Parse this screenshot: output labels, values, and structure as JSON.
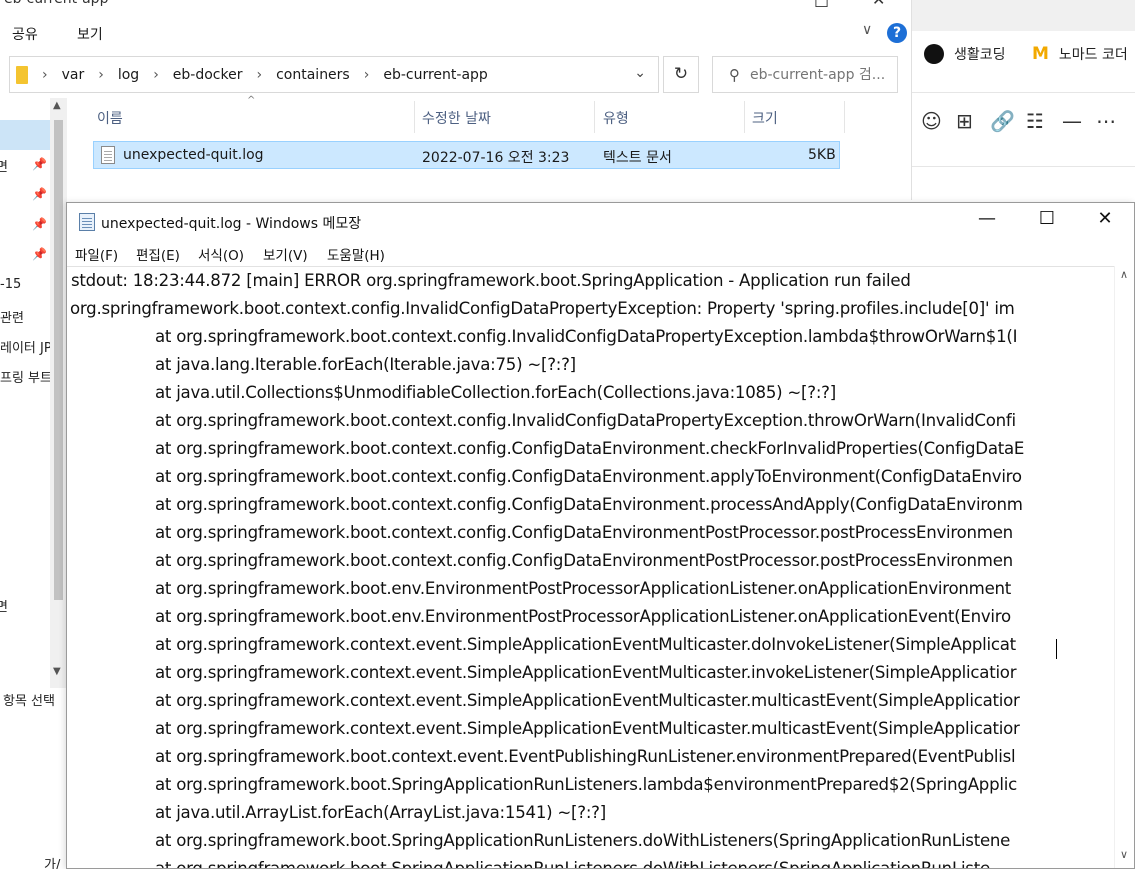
{
  "explorer": {
    "title_partial": "eb-current-app",
    "ribbon": {
      "share": "공유",
      "view": "보기"
    },
    "address": {
      "crumbs": [
        "var",
        "log",
        "eb-docker",
        "containers",
        "eb-current-app"
      ]
    },
    "search_placeholder": "eb-current-app 검...",
    "nav_fragments": [
      "면",
      "-15",
      "관련",
      "레이터 JP",
      "프링 부트",
      "면"
    ],
    "status_selected": "항목 선택",
    "status_bottom": "가/",
    "columns": {
      "name": "이름",
      "modified": "수정한 날짜",
      "type": "유형",
      "size": "크기"
    },
    "files": [
      {
        "name": "unexpected-quit.log",
        "modified": "2022-07-16 오전 3:23",
        "type": "텍스트 문서",
        "size": "5KB"
      }
    ]
  },
  "side_panel": {
    "bookmarks": [
      {
        "label": "생활코딩",
        "icon": "black-circle-icon"
      },
      {
        "label": "노마드 코더",
        "icon": "nomad-logo-icon"
      }
    ],
    "tools": [
      "emoji-icon",
      "table-icon",
      "link-icon",
      "list-icon",
      "divider-icon",
      "more-icon"
    ]
  },
  "notepad": {
    "title": "unexpected-quit.log - Windows 메모장",
    "menu": [
      "파일(F)",
      "편집(E)",
      "서식(O)",
      "보기(V)",
      "도움말(H)"
    ],
    "lines": [
      "stdout: 18:23:44.872 [main] ERROR org.springframework.boot.SpringApplication - Application run failed",
      "org.springframework.boot.context.config.InvalidConfigDataPropertyException: Property 'spring.profiles.include[0]' im",
      "\tat org.springframework.boot.context.config.InvalidConfigDataPropertyException.lambda$throwOrWarn$1(I",
      "\tat java.lang.Iterable.forEach(Iterable.java:75) ~[?:?]",
      "\tat java.util.Collections$UnmodifiableCollection.forEach(Collections.java:1085) ~[?:?]",
      "\tat org.springframework.boot.context.config.InvalidConfigDataPropertyException.throwOrWarn(InvalidConfi",
      "\tat org.springframework.boot.context.config.ConfigDataEnvironment.checkForInvalidProperties(ConfigDataE",
      "\tat org.springframework.boot.context.config.ConfigDataEnvironment.applyToEnvironment(ConfigDataEnviro",
      "\tat org.springframework.boot.context.config.ConfigDataEnvironment.processAndApply(ConfigDataEnvironm",
      "\tat org.springframework.boot.context.config.ConfigDataEnvironmentPostProcessor.postProcessEnvironmen",
      "\tat org.springframework.boot.context.config.ConfigDataEnvironmentPostProcessor.postProcessEnvironmen",
      "\tat org.springframework.boot.env.EnvironmentPostProcessorApplicationListener.onApplicationEnvironment",
      "\tat org.springframework.boot.env.EnvironmentPostProcessorApplicationListener.onApplicationEvent(Enviro",
      "\tat org.springframework.context.event.SimpleApplicationEventMulticaster.doInvokeListener(SimpleApplicat",
      "\tat org.springframework.context.event.SimpleApplicationEventMulticaster.invokeListener(SimpleApplicatior",
      "\tat org.springframework.context.event.SimpleApplicationEventMulticaster.multicastEvent(SimpleApplicatior",
      "\tat org.springframework.context.event.SimpleApplicationEventMulticaster.multicastEvent(SimpleApplicatior",
      "\tat org.springframework.boot.context.event.EventPublishingRunListener.environmentPrepared(EventPublisl",
      "\tat org.springframework.boot.SpringApplicationRunListeners.lambda$environmentPrepared$2(SpringApplic",
      "\tat java.util.ArrayList.forEach(ArrayList.java:1541) ~[?:?]",
      "\tat org.springframework.boot.SpringApplicationRunListeners.doWithListeners(SpringApplicationRunListene",
      "\tat org.springframework.boot.SpringApplicationRunListeners.doWithListeners(SpringApplicationRunListe"
    ]
  }
}
